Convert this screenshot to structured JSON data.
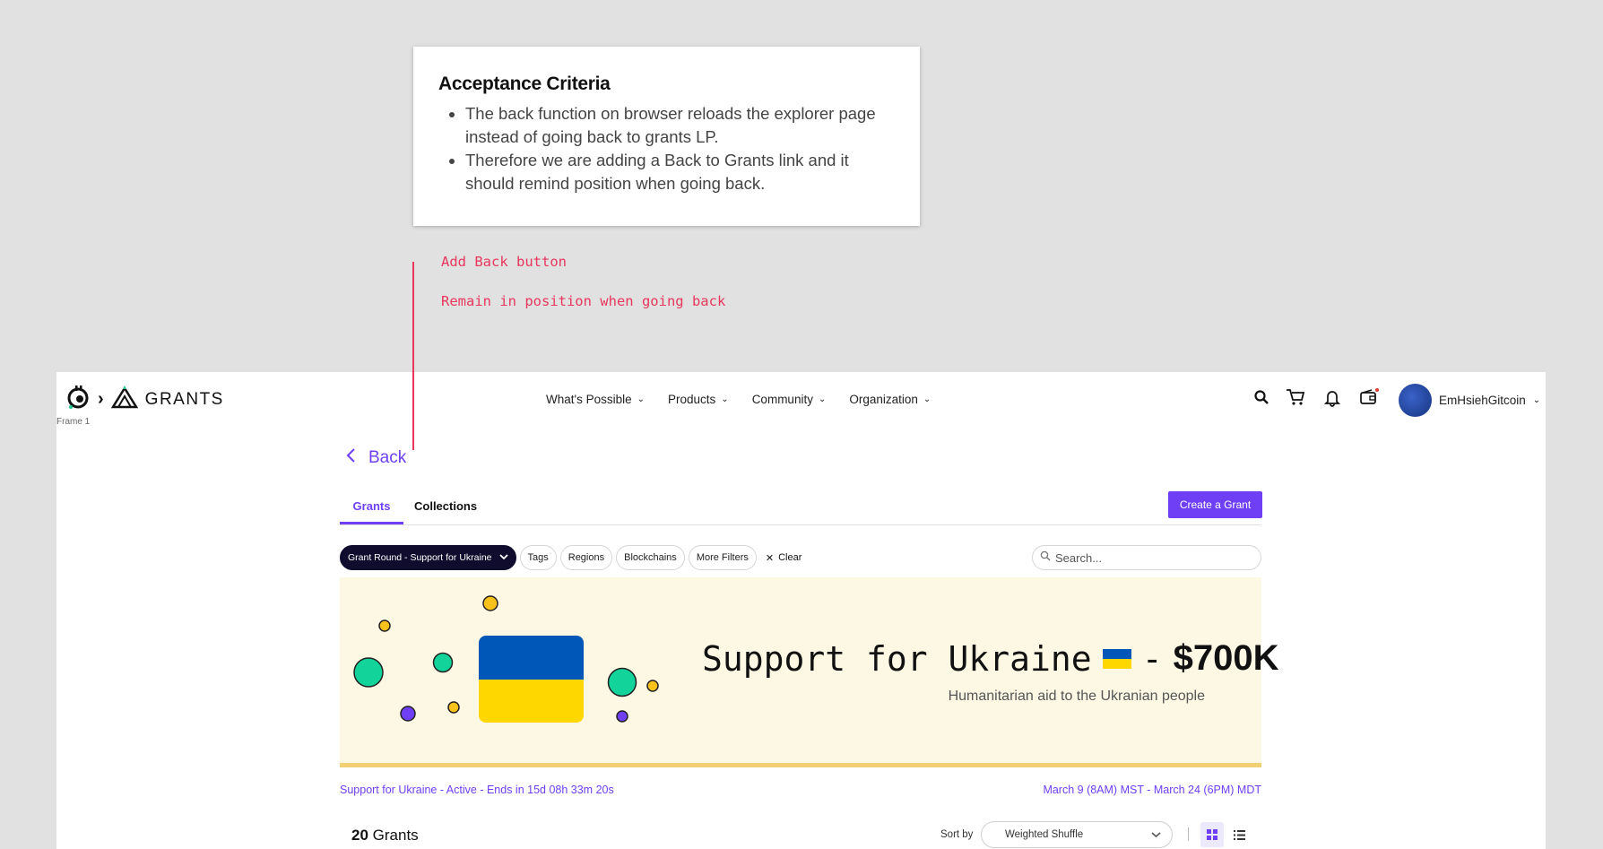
{
  "criteria": {
    "title": "Acceptance Criteria",
    "items": [
      "The back function on browser reloads the explorer page instead of going back to grants LP.",
      "Therefore we are adding a Back to Grants link and it should remind position when going back."
    ]
  },
  "notes": [
    "Add Back button",
    "Remain in position when going back"
  ],
  "frame_label": "Frame 1",
  "brand": {
    "name": "GRANTS"
  },
  "nav": [
    "What's Possible",
    "Products",
    "Community",
    "Organization"
  ],
  "user": {
    "name": "EmHsiehGitcoin"
  },
  "back_label": "Back",
  "tabs": [
    "Grants",
    "Collections"
  ],
  "create_button": "Create a Grant",
  "filters": {
    "round": "Grant Round - Support for Ukraine",
    "pills": [
      "Tags",
      "Regions",
      "Blockchains",
      "More Filters"
    ],
    "clear": "Clear"
  },
  "search": {
    "placeholder": "Search..."
  },
  "banner": {
    "title": "Support for Ukraine",
    "amount": "$700K",
    "subtitle": "Humanitarian aid to the Ukranian people"
  },
  "round_status": "Support for Ukraine - Active - Ends in 15d 08h 33m 20s",
  "round_dates": "March 9 (8AM) MST - March 24 (6PM) MDT",
  "grants_count": "20",
  "grants_label": "Grants",
  "sort": {
    "label": "Sort by",
    "value": "Weighted Shuffle"
  },
  "colors": {
    "accent": "#6f3ff5",
    "annotation": "#e8365d",
    "banner_bg": "#fdf8e4"
  }
}
